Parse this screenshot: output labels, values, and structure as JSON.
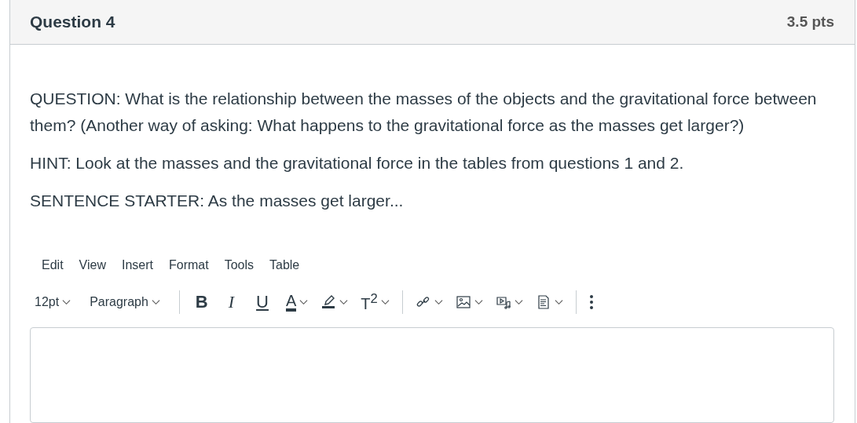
{
  "question": {
    "title": "Question 4",
    "points": "3.5 pts"
  },
  "paragraphs": [
    "QUESTION: What is the relationship between the masses of the objects and the gravitational force between them? (Another way of asking: What happens to the gravitational force as the masses get larger?)",
    "HINT: Look at the masses and the gravitational force in the tables from questions 1 and 2.",
    "SENTENCE STARTER: As the masses get larger..."
  ],
  "menu": [
    "Edit",
    "View",
    "Insert",
    "Format",
    "Tools",
    "Table"
  ],
  "toolbar_groups": [
    [
      {
        "kind": "dropdown",
        "label": "12pt"
      },
      {
        "kind": "dropdown",
        "label": "Paragraph"
      }
    ],
    [
      {
        "kind": "bold",
        "label": "B"
      },
      {
        "kind": "italic",
        "label": "I"
      },
      {
        "kind": "underline",
        "label": "U"
      },
      {
        "kind": "text-color",
        "label": "A"
      },
      {
        "kind": "highlight"
      },
      {
        "kind": "superscript",
        "label": "T$^{2}$"
      }
    ],
    [
      {
        "kind": "link"
      },
      {
        "kind": "image"
      },
      {
        "kind": "media"
      },
      {
        "kind": "document"
      }
    ],
    [
      {
        "kind": "more"
      }
    ]
  ]
}
